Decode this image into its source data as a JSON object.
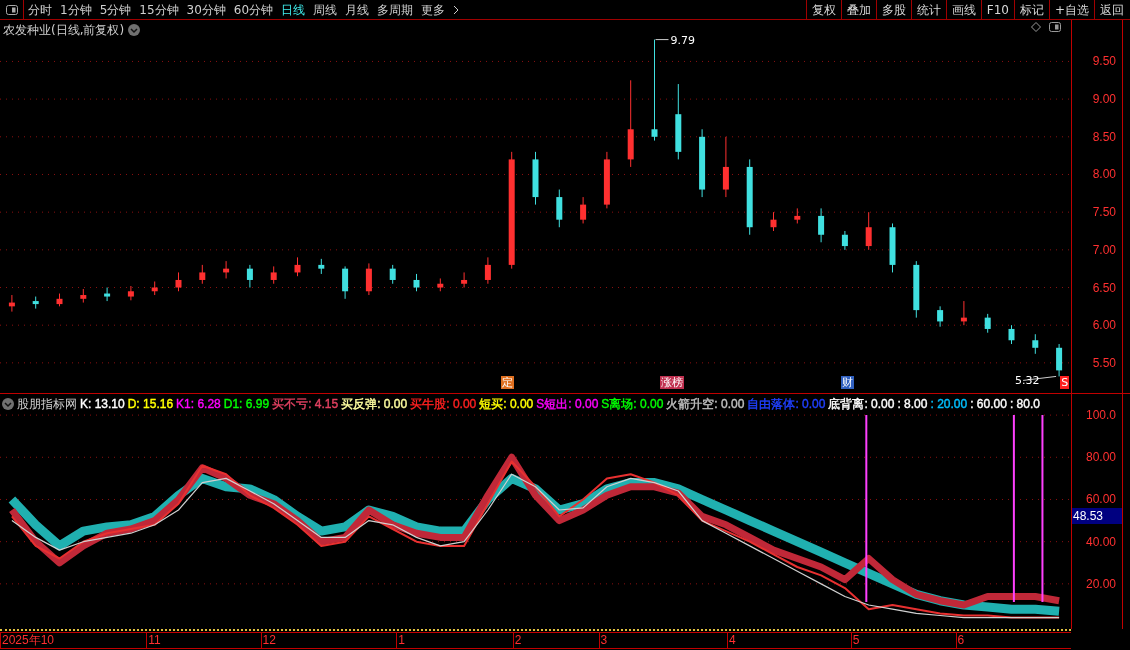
{
  "toolbar": {
    "periods": [
      {
        "label": "分时",
        "selected": false
      },
      {
        "label": "1分钟",
        "selected": false
      },
      {
        "label": "5分钟",
        "selected": false
      },
      {
        "label": "15分钟",
        "selected": false
      },
      {
        "label": "30分钟",
        "selected": false
      },
      {
        "label": "60分钟",
        "selected": false
      },
      {
        "label": "日线",
        "selected": true
      },
      {
        "label": "周线",
        "selected": false
      },
      {
        "label": "月线",
        "selected": false
      },
      {
        "label": "多周期",
        "selected": false
      },
      {
        "label": "更多",
        "selected": false
      }
    ],
    "buttons": [
      "复权",
      "叠加",
      "多股",
      "统计",
      "画线",
      "F10",
      "标记",
      "+自选",
      "返回"
    ]
  },
  "main_chart": {
    "title": "农发种业(日线,前复权)",
    "markers": [
      {
        "text": "定",
        "color": "#e07020"
      },
      {
        "text": "涨榜",
        "color": "#c03050"
      },
      {
        "text": "财",
        "color": "#3060c0"
      },
      {
        "text": "S",
        "color": "#ff2020"
      }
    ],
    "chart_data": {
      "type": "candlestick",
      "grid": true,
      "ylim": [
        5.1,
        10.05
      ],
      "yticks": [
        {
          "value": 5.5,
          "label": "5.50"
        },
        {
          "value": 6,
          "label": "6.00"
        },
        {
          "value": 6.5,
          "label": "6.50"
        },
        {
          "value": 7,
          "label": "7.00"
        },
        {
          "value": 7.5,
          "label": "7.50"
        },
        {
          "value": 8,
          "label": "8.00"
        },
        {
          "value": 8.5,
          "label": "8.50"
        },
        {
          "value": 9,
          "label": "9.00"
        },
        {
          "value": 9.5,
          "label": "9.50"
        }
      ],
      "ohlc": [
        [
          6.25,
          6.4,
          6.18,
          6.3
        ],
        [
          6.32,
          6.38,
          6.22,
          6.28
        ],
        [
          6.28,
          6.42,
          6.25,
          6.35
        ],
        [
          6.35,
          6.48,
          6.3,
          6.4
        ],
        [
          6.42,
          6.5,
          6.32,
          6.38
        ],
        [
          6.38,
          6.52,
          6.33,
          6.45
        ],
        [
          6.45,
          6.58,
          6.4,
          6.5
        ],
        [
          6.5,
          6.7,
          6.45,
          6.6
        ],
        [
          6.6,
          6.8,
          6.55,
          6.7
        ],
        [
          6.7,
          6.85,
          6.62,
          6.75
        ],
        [
          6.75,
          6.8,
          6.5,
          6.6
        ],
        [
          6.6,
          6.78,
          6.55,
          6.7
        ],
        [
          6.7,
          6.9,
          6.65,
          6.8
        ],
        [
          6.8,
          6.88,
          6.68,
          6.75
        ],
        [
          6.75,
          6.78,
          6.35,
          6.45
        ],
        [
          6.45,
          6.82,
          6.4,
          6.75
        ],
        [
          6.75,
          6.8,
          6.55,
          6.6
        ],
        [
          6.6,
          6.68,
          6.45,
          6.5
        ],
        [
          6.5,
          6.62,
          6.45,
          6.55
        ],
        [
          6.55,
          6.7,
          6.5,
          6.6
        ],
        [
          6.6,
          6.9,
          6.55,
          6.8
        ],
        [
          6.8,
          8.3,
          6.75,
          8.2
        ],
        [
          8.2,
          8.3,
          7.6,
          7.7
        ],
        [
          7.7,
          7.8,
          7.3,
          7.4
        ],
        [
          7.4,
          7.7,
          7.35,
          7.6
        ],
        [
          7.6,
          8.3,
          7.55,
          8.2
        ],
        [
          8.2,
          9.25,
          8.1,
          8.6
        ],
        [
          8.6,
          9.79,
          8.45,
          8.5
        ],
        [
          8.8,
          9.2,
          8.2,
          8.3
        ],
        [
          8.5,
          8.6,
          7.7,
          7.8
        ],
        [
          7.8,
          8.5,
          7.7,
          8.1
        ],
        [
          8.1,
          8.2,
          7.2,
          7.3
        ],
        [
          7.3,
          7.5,
          7.25,
          7.4
        ],
        [
          7.4,
          7.55,
          7.35,
          7.45
        ],
        [
          7.45,
          7.55,
          7.1,
          7.2
        ],
        [
          7.2,
          7.25,
          7.0,
          7.05
        ],
        [
          7.05,
          7.5,
          7.0,
          7.3
        ],
        [
          7.3,
          7.35,
          6.7,
          6.8
        ],
        [
          6.8,
          6.85,
          6.1,
          6.2
        ],
        [
          6.2,
          6.25,
          5.98,
          6.05
        ],
        [
          6.05,
          6.32,
          6.0,
          6.1
        ],
        [
          6.1,
          6.15,
          5.9,
          5.95
        ],
        [
          5.95,
          6.0,
          5.75,
          5.8
        ],
        [
          5.8,
          5.88,
          5.62,
          5.7
        ],
        [
          5.7,
          5.75,
          5.32,
          5.4
        ]
      ],
      "annotations": [
        "9.79",
        "5.32"
      ]
    }
  },
  "indicator": {
    "name": "股朋指标网",
    "legend": [
      {
        "text": "K: 13.10",
        "color": "#ffffff"
      },
      {
        "text": "D: 15.16",
        "color": "#ffff00"
      },
      {
        "text": "K1: 6.28",
        "color": "#ff00ff"
      },
      {
        "text": "D1: 6.99",
        "color": "#00ff00"
      },
      {
        "text": "买不亏: 4.15",
        "color": "#e04060"
      },
      {
        "text": "买反弹: 0.00",
        "color": "#ffffa0"
      },
      {
        "text": "买牛股: 0.00",
        "color": "#ff2020"
      },
      {
        "text": "短买: 0.00",
        "color": "#ffff00"
      },
      {
        "text": "S短出: 0.00",
        "color": "#ff00ff"
      },
      {
        "text": "S离场: 0.00",
        "color": "#00ff00"
      },
      {
        "text": "火箭升空: 0.00",
        "color": "#c0c0c0"
      },
      {
        "text": "自由落体: 0.00",
        "color": "#2040ff"
      },
      {
        "text": "底背离: 0.00",
        "color": "#ffffff"
      },
      {
        "text": ": 8.00",
        "color": "#ffffff"
      },
      {
        "text": ": 20.00",
        "color": "#00c0ff"
      },
      {
        "text": ": 60.00",
        "color": "#ffffff"
      },
      {
        "text": ": 80.0",
        "color": "#ffffff"
      }
    ],
    "current_value": "48.53",
    "date_axis": [
      "2025年10",
      "11",
      "12",
      "1",
      "2",
      "3",
      "4",
      "5",
      "6"
    ],
    "chart_data": {
      "type": "line",
      "grid": true,
      "ylim": [
        -1.4,
        110
      ],
      "yticks": [
        {
          "value": 20,
          "label": "20.00"
        },
        {
          "value": 40,
          "label": "40.00"
        },
        {
          "value": 60,
          "label": "60.00"
        },
        {
          "value": 80,
          "label": "80.00"
        },
        {
          "value": 100,
          "label": "100.0"
        }
      ],
      "series": [
        {
          "color": "#20b0b0",
          "values": [
            60,
            48,
            38,
            45,
            47,
            48,
            52,
            62,
            70,
            66,
            65,
            60,
            52,
            45,
            47,
            55,
            52,
            47,
            45,
            45,
            60,
            70,
            65,
            55,
            58,
            65,
            68,
            68,
            65,
            60,
            55,
            50,
            45,
            40,
            35,
            30,
            25,
            20,
            15,
            12,
            10,
            9,
            8,
            8,
            7
          ]
        },
        {
          "color": "#c02838",
          "values": [
            55,
            40,
            30,
            38,
            44,
            46,
            50,
            60,
            75,
            70,
            62,
            58,
            50,
            40,
            42,
            55,
            48,
            44,
            42,
            42,
            62,
            80,
            62,
            50,
            55,
            62,
            66,
            66,
            63,
            52,
            48,
            42,
            36,
            32,
            28,
            22,
            32,
            22,
            15,
            12,
            10,
            14,
            14,
            14,
            12
          ]
        },
        {
          "color": "#e83030",
          "values": [
            52,
            38,
            32,
            40,
            44,
            46,
            48,
            58,
            76,
            72,
            62,
            56,
            48,
            38,
            40,
            52,
            46,
            40,
            38,
            38,
            58,
            78,
            66,
            52,
            60,
            70,
            72,
            68,
            62,
            50,
            45,
            40,
            34,
            28,
            24,
            18,
            8,
            10,
            8,
            6,
            5,
            5,
            4,
            4,
            4
          ]
        },
        {
          "color": "#d0d0d0",
          "values": [
            50,
            42,
            36,
            40,
            42,
            44,
            48,
            55,
            68,
            70,
            64,
            58,
            50,
            42,
            42,
            50,
            48,
            42,
            38,
            40,
            55,
            72,
            66,
            55,
            56,
            66,
            70,
            68,
            64,
            50,
            44,
            38,
            32,
            26,
            20,
            14,
            10,
            8,
            6,
            5,
            4,
            4,
            4,
            4,
            4
          ]
        }
      ]
    }
  }
}
